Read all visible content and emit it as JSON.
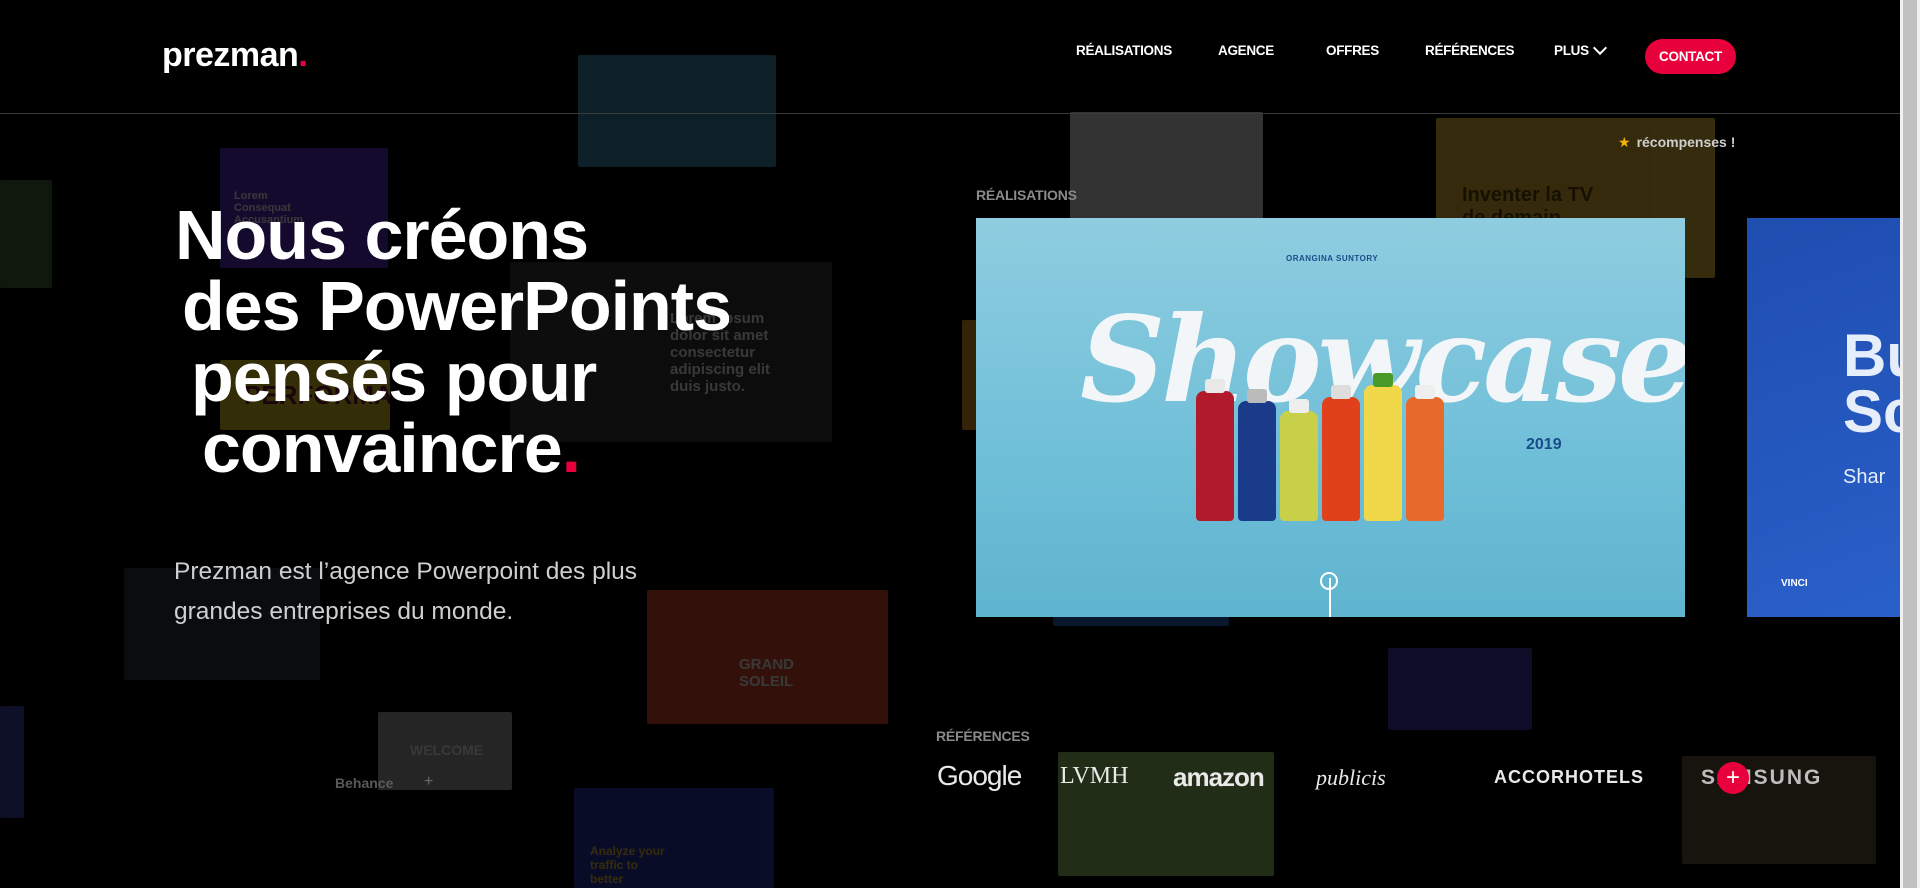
{
  "header": {
    "logo_text": "prezman",
    "logo_dot": ".",
    "nav": [
      "RÉALISATIONS",
      "AGENCE",
      "OFFRES",
      "RÉFÉRENCES",
      "PLUS"
    ],
    "contact_label": "CONTACT"
  },
  "hero": {
    "title_lines": [
      "Nous créons",
      "des PowerPoints",
      "pensés pour",
      "convaincre"
    ],
    "title_dot": ".",
    "subtitle": "Prezman est l’agence Powerpoint des plus grandes entreprises du monde."
  },
  "awards": {
    "text": "récompenses !"
  },
  "realisations": {
    "label": "RÉALISATIONS",
    "showcase": {
      "brand": "ORANGINA SUNTORY",
      "word": "Showcase",
      "year": "2019"
    },
    "next_card": {
      "title_lines": [
        "Bu",
        "Sc"
      ],
      "share": "Shar",
      "brand": "VINCI"
    }
  },
  "references": {
    "label": "RÉFÉRENCES",
    "logos": [
      "Google",
      "LVMH",
      "amazon",
      "publicis",
      "ACCORHOTELS",
      "SAMSUNG"
    ],
    "more_label": "+"
  },
  "footer": {
    "behance": "Behance",
    "behance_plus": "+"
  },
  "background": {
    "thumb_texts": [
      "Lorem Consequat Accusantium",
      "Lorem ipsum dolor sit amet consectetur adipiscing elit duis justo.",
      "GRAND SOLEIL",
      "WELCOME",
      "Analyze your traffic to better convert it.",
      "Inventer la TV de demain",
      "PERFORMANCE"
    ]
  },
  "colors": {
    "accent": "#e8003d",
    "background": "#000000",
    "showcase_bg": "#7dc6dc"
  }
}
